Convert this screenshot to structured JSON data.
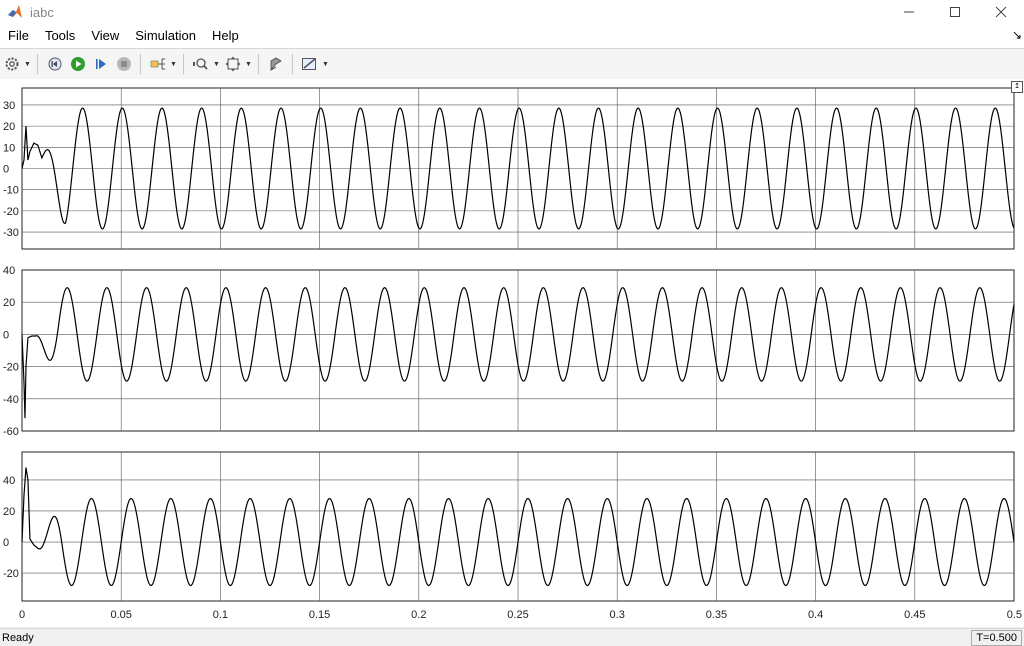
{
  "window": {
    "title": "iabc",
    "app_icon": "matlab-logo-icon",
    "controls": [
      "minimize-icon",
      "maximize-icon",
      "close-icon"
    ]
  },
  "menu": {
    "items": [
      {
        "label": "File"
      },
      {
        "label": "Tools"
      },
      {
        "label": "View"
      },
      {
        "label": "Simulation"
      },
      {
        "label": "Help"
      }
    ]
  },
  "toolbar": {
    "buttons": [
      "settings-gear-icon",
      "restore-icon",
      "run-icon",
      "step-forward-icon",
      "stop-icon",
      "signal-selector-icon",
      "zoom-icon",
      "autoscale-icon",
      "highlight-block-icon",
      "measurement-icon"
    ],
    "colors": {
      "run": "#2e9d2e",
      "step": "#2a6bc4",
      "stop": "#9a9a9a"
    }
  },
  "status": {
    "left": "Ready",
    "right": "T=0.500"
  },
  "chart_data": [
    {
      "type": "line",
      "title": "",
      "xlabel": "",
      "ylabel": "",
      "xlim": [
        0,
        0.5
      ],
      "ylim": [
        -38,
        38
      ],
      "yticks": [
        "30",
        "20",
        "10",
        "0",
        "-10",
        "-20",
        "-30"
      ],
      "ytick_values": [
        30,
        20,
        10,
        0,
        -10,
        -20,
        -30
      ],
      "grid": true,
      "series": [
        {
          "description": "phase a current: ~50 Hz sinusoid, amplitude ~28-30 with startup transient",
          "frequency_hz": 50,
          "amplitude": 28.5,
          "phase_deg": -100,
          "x": [
            0,
            0.001,
            0.002,
            0.003,
            0.004,
            0.006,
            0.008,
            0.01
          ],
          "y": [
            0,
            4,
            20,
            4,
            8,
            12,
            11,
            5
          ]
        }
      ]
    },
    {
      "type": "line",
      "title": "",
      "xlabel": "",
      "ylabel": "",
      "xlim": [
        0,
        0.5
      ],
      "ylim": [
        -60,
        40
      ],
      "yticks": [
        "40",
        "20",
        "0",
        "-20",
        "-40",
        "-60"
      ],
      "ytick_values": [
        40,
        20,
        0,
        -20,
        -40,
        -60
      ],
      "grid": true,
      "series": [
        {
          "description": "phase b current: ~50 Hz sinusoid, amplitude ~29 with startup spike to about -52",
          "frequency_hz": 50,
          "amplitude": 29,
          "phase_deg": 40,
          "x": [
            0,
            0.001,
            0.0015,
            0.002,
            0.003,
            0.005,
            0.007
          ],
          "y": [
            0,
            -30,
            -52,
            -20,
            -2,
            -1,
            -1
          ]
        }
      ]
    },
    {
      "type": "line",
      "title": "",
      "xlabel": "",
      "ylabel": "",
      "xlim": [
        0,
        0.5
      ],
      "ylim": [
        -38,
        58
      ],
      "yticks": [
        "40",
        "20",
        "0",
        "-20"
      ],
      "ytick_values": [
        40,
        20,
        0,
        -20
      ],
      "xticks": [
        "0",
        "0.05",
        "0.1",
        "0.15",
        "0.2",
        "0.25",
        "0.3",
        "0.35",
        "0.4",
        "0.45",
        "0.5"
      ],
      "xtick_values": [
        0,
        0.05,
        0.1,
        0.15,
        0.2,
        0.25,
        0.3,
        0.35,
        0.4,
        0.45,
        0.5
      ],
      "grid": true,
      "series": [
        {
          "description": "phase c current: ~50 Hz sinusoid, amplitude ~28 with startup spike to about 50",
          "frequency_hz": 50,
          "amplitude": 28,
          "phase_deg": 180,
          "x": [
            0,
            0.001,
            0.002,
            0.003,
            0.004,
            0.006,
            0.008
          ],
          "y": [
            0,
            30,
            48,
            40,
            2,
            -2,
            -4
          ]
        }
      ]
    }
  ]
}
